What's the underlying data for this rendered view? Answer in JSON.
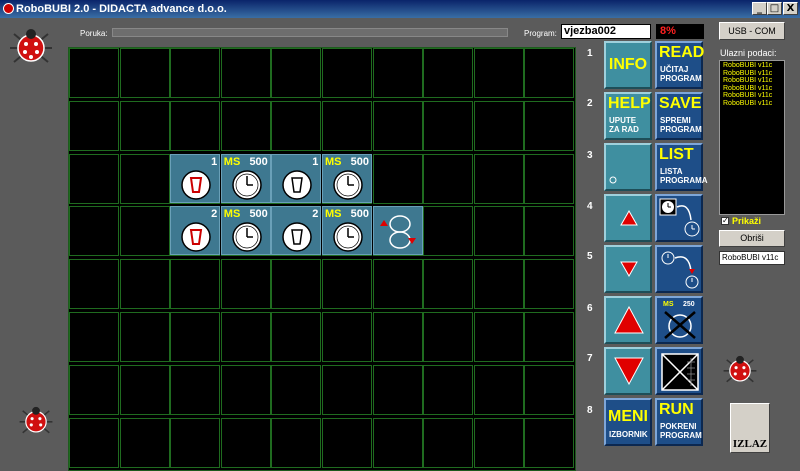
{
  "window": {
    "title": "RoboBUBI 2.0 - DIDACTA advance d.o.o.",
    "min": "_",
    "max": "□",
    "close": "X"
  },
  "header": {
    "poruka_label": "Poruka:",
    "program_label": "Program:",
    "program_value": "vjezba002",
    "percent": "8%"
  },
  "program_grid": {
    "rows": 8,
    "cols": 10,
    "commands": [
      {
        "row": 2,
        "col": 2,
        "kind": "pen",
        "num": "1"
      },
      {
        "row": 2,
        "col": 3,
        "kind": "clock",
        "ms": "MS",
        "val": "500"
      },
      {
        "row": 2,
        "col": 4,
        "kind": "pen-up",
        "num": "1"
      },
      {
        "row": 2,
        "col": 5,
        "kind": "clock",
        "ms": "MS",
        "val": "500"
      },
      {
        "row": 3,
        "col": 2,
        "kind": "pen",
        "num": "2"
      },
      {
        "row": 3,
        "col": 3,
        "kind": "clock",
        "ms": "MS",
        "val": "500"
      },
      {
        "row": 3,
        "col": 4,
        "kind": "pen-up",
        "num": "2"
      },
      {
        "row": 3,
        "col": 5,
        "kind": "clock",
        "ms": "MS",
        "val": "500"
      },
      {
        "row": 3,
        "col": 6,
        "kind": "loop"
      }
    ]
  },
  "row_numbers": [
    "1",
    "2",
    "3",
    "4",
    "5",
    "6",
    "7",
    "8"
  ],
  "buttons": {
    "info": "INFO",
    "help": "HELP",
    "help_sub1": "UPUTE",
    "help_sub2": "ZA RAD",
    "read": "READ",
    "read_sub1": "UČITAJ",
    "read_sub2": "PROGRAM",
    "save": "SAVE",
    "save_sub1": "SPREMI",
    "save_sub2": "PROGRAM",
    "list": "LIST",
    "list_sub1": "LISTA",
    "list_sub2": "PROGRAMA",
    "meni": "MENI",
    "meni_sub": "IZBORNIK",
    "run": "RUN",
    "run_sub1": "POKRENI",
    "run_sub2": "PROGRAM",
    "cmd_ms": "MS",
    "cmd_ms_val": "250"
  },
  "right_panel": {
    "usb": "USB - COM",
    "inputs_label": "Ulazni podaci:",
    "inputs": [
      "RoboBUBI v11c",
      "RoboBUBI v11c",
      "RoboBUBI v11c",
      "RoboBUBI v11c",
      "RoboBUBI v11c",
      "RoboBUBI v11c"
    ],
    "prikazi_check": "✓",
    "prikazi": "Prikaži",
    "obrisi": "Obriši",
    "version": "RoboBUBI v11c",
    "izlaz": "IZLAZ"
  },
  "colors": {
    "accent_yellow": "#ffff00",
    "panel_teal": "#3f8fa0",
    "panel_blue": "#1e4e88",
    "grid_green": "#1f6b1f",
    "alert_red": "#ff2020"
  }
}
